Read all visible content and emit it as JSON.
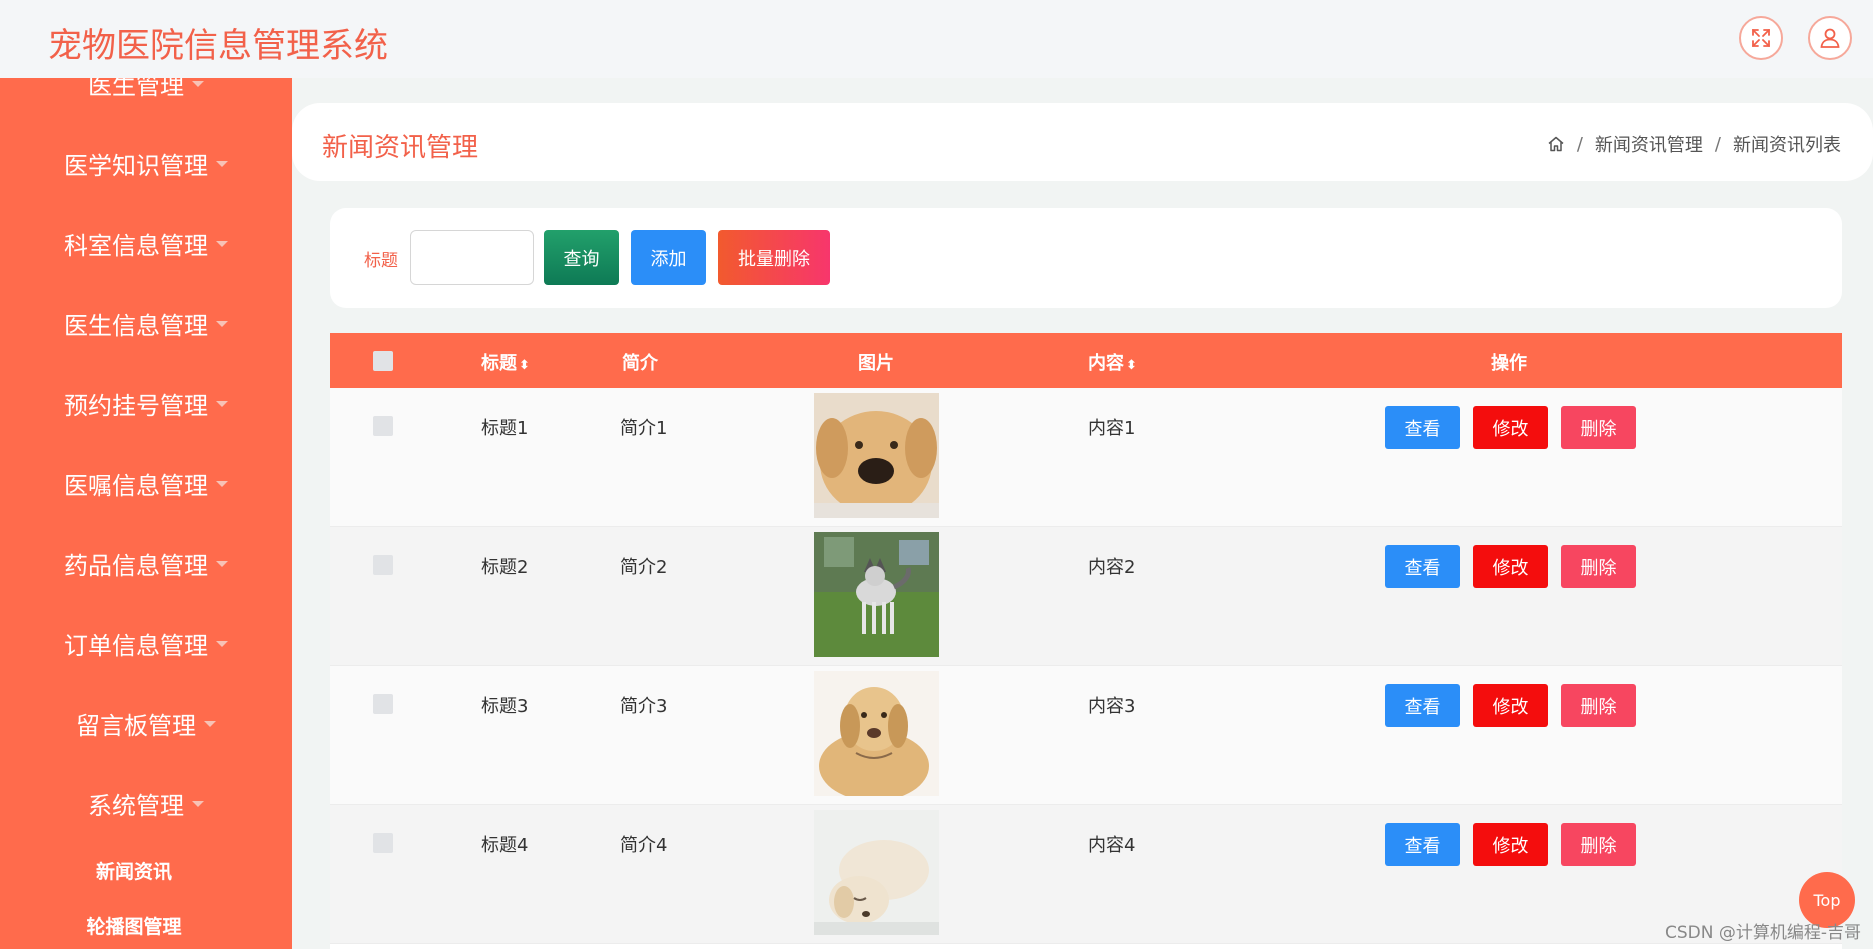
{
  "header": {
    "title": "宠物医院信息管理系统"
  },
  "sidebar": {
    "items": [
      {
        "label": "医生管理"
      },
      {
        "label": "医学知识管理"
      },
      {
        "label": "科室信息管理"
      },
      {
        "label": "医生信息管理"
      },
      {
        "label": "预约挂号管理"
      },
      {
        "label": "医嘱信息管理"
      },
      {
        "label": "药品信息管理"
      },
      {
        "label": "订单信息管理"
      },
      {
        "label": "留言板管理"
      },
      {
        "label": "系统管理"
      }
    ],
    "subitems": [
      {
        "label": "新闻资讯"
      },
      {
        "label": "轮播图管理"
      }
    ]
  },
  "page": {
    "title": "新闻资讯管理",
    "breadcrumb": [
      "新闻资讯管理",
      "新闻资讯列表"
    ],
    "breadcrumb_sep": "/"
  },
  "search": {
    "label": "标题",
    "value": "",
    "query_label": "查询",
    "add_label": "添加",
    "batch_delete_label": "批量删除"
  },
  "table": {
    "headers": {
      "title": "标题",
      "summary": "简介",
      "image": "图片",
      "content": "内容",
      "actions": "操作"
    },
    "rows": [
      {
        "title": "标题1",
        "summary": "简介1",
        "content": "内容1"
      },
      {
        "title": "标题2",
        "summary": "简介2",
        "content": "内容2"
      },
      {
        "title": "标题3",
        "summary": "简介3",
        "content": "内容3"
      },
      {
        "title": "标题4",
        "summary": "简介4",
        "content": "内容4"
      }
    ],
    "action_labels": {
      "view": "查看",
      "edit": "修改",
      "delete": "删除"
    }
  },
  "floating": {
    "top_label": "Top",
    "watermark": "CSDN @计算机编程-吉哥"
  },
  "colors": {
    "accent": "#ff6b4c",
    "title_text": "#f2614a",
    "view": "#2b8ef8",
    "edit": "#f40d0d",
    "delete": "#f74660"
  }
}
